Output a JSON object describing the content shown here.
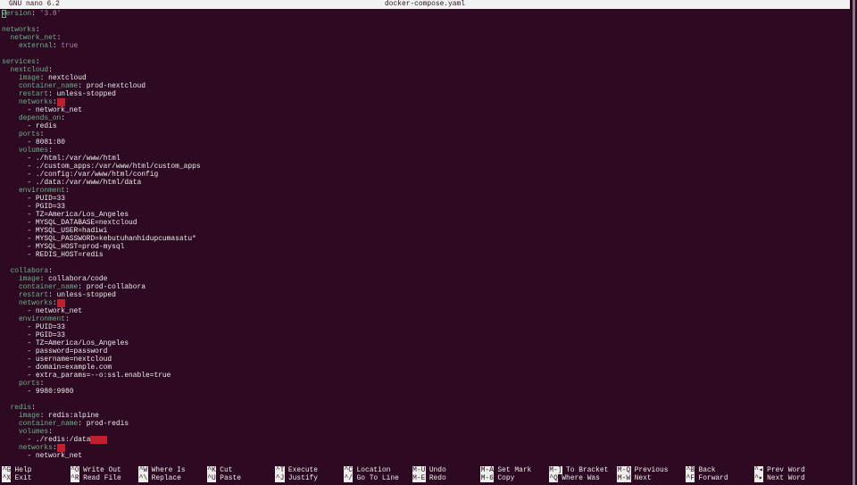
{
  "titlebar": {
    "app": "GNU nano 6.2",
    "filename": "docker-compose.yaml"
  },
  "colors": {
    "background": "#2d0922",
    "key": "#6bb38a",
    "string": "#b57fb5",
    "trailing_whitespace": "#c0202e"
  },
  "lines": [
    [
      {
        "t": "version",
        "c": "k cursor-first"
      },
      {
        "t": ": ",
        "c": "v"
      },
      {
        "t": "'3.8'",
        "c": "s"
      }
    ],
    [],
    [
      {
        "t": "networks",
        "c": "k"
      },
      {
        "t": ":",
        "c": "v"
      }
    ],
    [
      {
        "t": "  network_net",
        "c": "k"
      },
      {
        "t": ":",
        "c": "v"
      }
    ],
    [
      {
        "t": "    external",
        "c": "k"
      },
      {
        "t": ": ",
        "c": "v"
      },
      {
        "t": "true",
        "c": "s"
      }
    ],
    [],
    [
      {
        "t": "services",
        "c": "k"
      },
      {
        "t": ":",
        "c": "v"
      }
    ],
    [
      {
        "t": "  nextcloud",
        "c": "k"
      },
      {
        "t": ":",
        "c": "v"
      }
    ],
    [
      {
        "t": "    image",
        "c": "k"
      },
      {
        "t": ": nextcloud",
        "c": "v"
      }
    ],
    [
      {
        "t": "    container_name",
        "c": "k"
      },
      {
        "t": ": prod-nextcloud",
        "c": "v"
      }
    ],
    [
      {
        "t": "    restart",
        "c": "k"
      },
      {
        "t": ": unless-stopped",
        "c": "v"
      }
    ],
    [
      {
        "t": "    networks",
        "c": "k"
      },
      {
        "t": ":",
        "c": "v"
      },
      {
        "t": "  ",
        "c": "ws"
      }
    ],
    [
      {
        "t": "      - network_net",
        "c": "v"
      }
    ],
    [
      {
        "t": "    depends_on",
        "c": "k"
      },
      {
        "t": ":",
        "c": "v"
      }
    ],
    [
      {
        "t": "      - redis",
        "c": "v"
      }
    ],
    [
      {
        "t": "    ports",
        "c": "k"
      },
      {
        "t": ":",
        "c": "v"
      }
    ],
    [
      {
        "t": "      - 8081:80",
        "c": "v"
      }
    ],
    [
      {
        "t": "    volumes",
        "c": "k"
      },
      {
        "t": ":",
        "c": "v"
      }
    ],
    [
      {
        "t": "      - ./html:/var/www/html",
        "c": "v"
      }
    ],
    [
      {
        "t": "      - ./custom_apps:/var/www/html/custom_apps",
        "c": "v"
      }
    ],
    [
      {
        "t": "      - ./config:/var/www/html/config",
        "c": "v"
      }
    ],
    [
      {
        "t": "      - ./data:/var/www/html/data",
        "c": "v"
      }
    ],
    [
      {
        "t": "    environment",
        "c": "k"
      },
      {
        "t": ":",
        "c": "v"
      }
    ],
    [
      {
        "t": "      - PUID=33",
        "c": "v"
      }
    ],
    [
      {
        "t": "      - PGID=33",
        "c": "v"
      }
    ],
    [
      {
        "t": "      - TZ=America/Los_Angeles",
        "c": "v"
      }
    ],
    [
      {
        "t": "      - MYSQL_DATABASE=nextcloud",
        "c": "v"
      }
    ],
    [
      {
        "t": "      - MYSQL_USER=hadiwi",
        "c": "v"
      }
    ],
    [
      {
        "t": "      - MYSQL_PASSWORD=kebutuhanhidupcumasatu*",
        "c": "v"
      }
    ],
    [
      {
        "t": "      - MYSQL_HOST=prod-mysql",
        "c": "v"
      }
    ],
    [
      {
        "t": "      - REDIS_HOST=redis",
        "c": "v"
      }
    ],
    [],
    [
      {
        "t": "  collabora",
        "c": "k"
      },
      {
        "t": ":",
        "c": "v"
      }
    ],
    [
      {
        "t": "    image",
        "c": "k"
      },
      {
        "t": ": collabora/code",
        "c": "v"
      }
    ],
    [
      {
        "t": "    container_name",
        "c": "k"
      },
      {
        "t": ": prod-collabora",
        "c": "v"
      }
    ],
    [
      {
        "t": "    restart",
        "c": "k"
      },
      {
        "t": ": unless-stopped",
        "c": "v"
      }
    ],
    [
      {
        "t": "    networks",
        "c": "k"
      },
      {
        "t": ":",
        "c": "v"
      },
      {
        "t": "  ",
        "c": "ws"
      }
    ],
    [
      {
        "t": "      - network_net",
        "c": "v"
      }
    ],
    [
      {
        "t": "    environment",
        "c": "k"
      },
      {
        "t": ":",
        "c": "v"
      }
    ],
    [
      {
        "t": "      - PUID=33",
        "c": "v"
      }
    ],
    [
      {
        "t": "      - PGID=33",
        "c": "v"
      }
    ],
    [
      {
        "t": "      - TZ=America/Los_Angeles",
        "c": "v"
      }
    ],
    [
      {
        "t": "      - password=password",
        "c": "v"
      }
    ],
    [
      {
        "t": "      - username=nextcloud",
        "c": "v"
      }
    ],
    [
      {
        "t": "      - domain=example.com",
        "c": "v"
      }
    ],
    [
      {
        "t": "      - extra_params=--o:ssl.enable=true",
        "c": "v"
      }
    ],
    [
      {
        "t": "    ports",
        "c": "k"
      },
      {
        "t": ":",
        "c": "v"
      }
    ],
    [
      {
        "t": "      - 9980:9980",
        "c": "v"
      }
    ],
    [],
    [
      {
        "t": "  redis",
        "c": "k"
      },
      {
        "t": ":",
        "c": "v"
      }
    ],
    [
      {
        "t": "    image",
        "c": "k"
      },
      {
        "t": ": redis:alpine",
        "c": "v"
      }
    ],
    [
      {
        "t": "    container_name",
        "c": "k"
      },
      {
        "t": ": prod-redis",
        "c": "v"
      }
    ],
    [
      {
        "t": "    volumes",
        "c": "k"
      },
      {
        "t": ":",
        "c": "v"
      }
    ],
    [
      {
        "t": "      - ./redis:/data",
        "c": "v"
      },
      {
        "t": "    ",
        "c": "ws"
      }
    ],
    [
      {
        "t": "    networks",
        "c": "k"
      },
      {
        "t": ":",
        "c": "v"
      },
      {
        "t": "  ",
        "c": "ws"
      }
    ],
    [
      {
        "t": "      - network_net",
        "c": "v"
      }
    ]
  ],
  "shortcuts": [
    [
      {
        "key": "^G",
        "label": "Help"
      },
      {
        "key": "^O",
        "label": "Write Out"
      },
      {
        "key": "^W",
        "label": "Where Is"
      },
      {
        "key": "^K",
        "label": "Cut"
      },
      {
        "key": "^T",
        "label": "Execute"
      },
      {
        "key": "^C",
        "label": "Location"
      },
      {
        "key": "M-U",
        "label": "Undo"
      },
      {
        "key": "M-A",
        "label": "Set Mark"
      },
      {
        "key": "M-]",
        "label": "To Bracket"
      },
      {
        "key": "M-Q",
        "label": "Previous"
      },
      {
        "key": "^B",
        "label": "Back"
      },
      {
        "key": "^◂",
        "label": "Prev Word"
      }
    ],
    [
      {
        "key": "^X",
        "label": "Exit"
      },
      {
        "key": "^R",
        "label": "Read File"
      },
      {
        "key": "^\\",
        "label": "Replace"
      },
      {
        "key": "^U",
        "label": "Paste"
      },
      {
        "key": "^J",
        "label": "Justify"
      },
      {
        "key": "^/",
        "label": "Go To Line"
      },
      {
        "key": "M-E",
        "label": "Redo"
      },
      {
        "key": "M-6",
        "label": "Copy"
      },
      {
        "key": "^Q",
        "label": "Where Was"
      },
      {
        "key": "M-W",
        "label": "Next"
      },
      {
        "key": "^F",
        "label": "Forward"
      },
      {
        "key": "^▸",
        "label": "Next Word"
      }
    ]
  ]
}
